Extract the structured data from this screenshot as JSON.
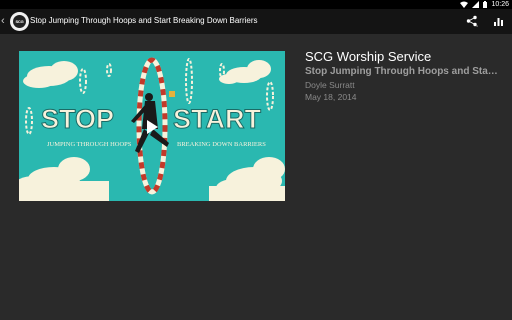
{
  "status_bar": {
    "time": "10:26"
  },
  "app_bar": {
    "logo_text": "SCG",
    "title": "Stop Jumping Through Hoops and Start Breaking Down Barriers",
    "actions": [
      "share-icon",
      "stats-icon"
    ]
  },
  "video": {
    "headline_left": "STOP",
    "headline_right": "START",
    "sub_left": "JUMPING THROUGH HOOPS",
    "sub_right": "BREAKING DOWN BARRIERS"
  },
  "details": {
    "service": "SCG Worship Service",
    "sermon_title": "Stop Jumping Through Hoops and Sta…",
    "speaker": "Doyle Surratt",
    "date": "May 18, 2014"
  },
  "colors": {
    "thumb_bg": "#2ab8b0",
    "cream": "#f7f2dc",
    "hoop_red": "#c23a2a",
    "background": "#2a2a2a"
  }
}
